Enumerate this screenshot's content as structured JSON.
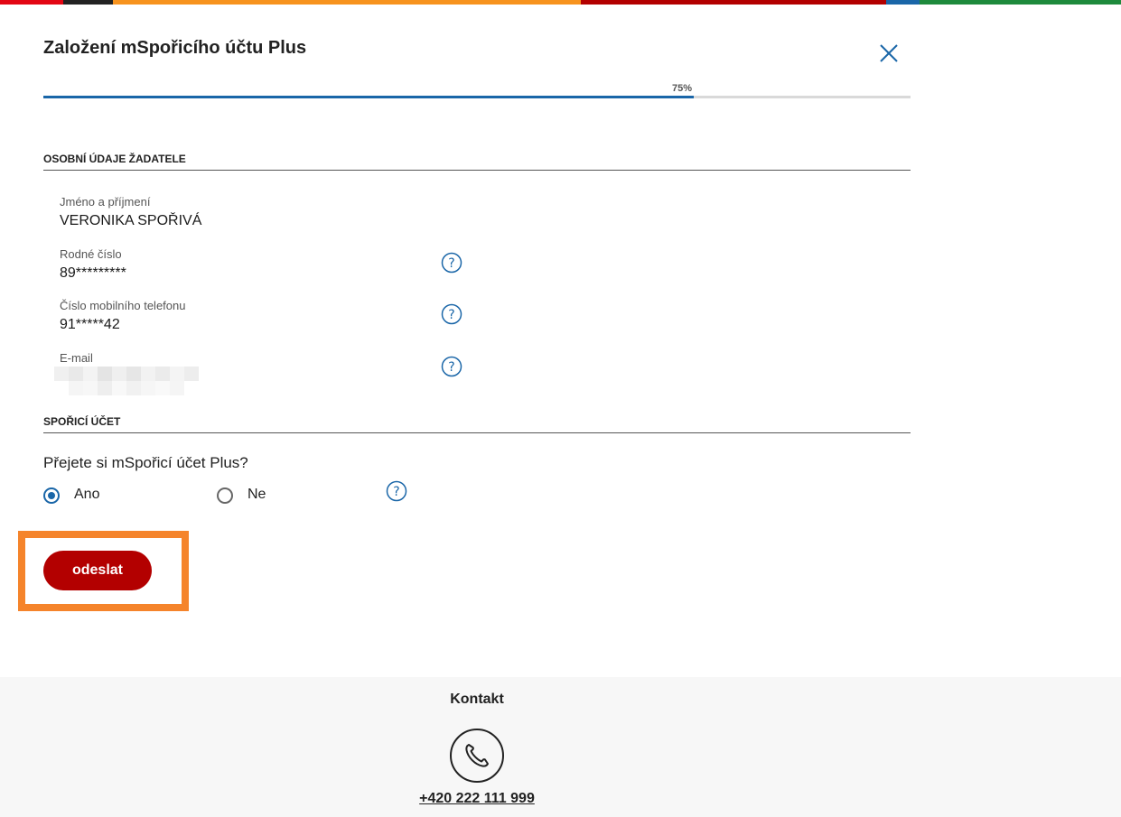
{
  "colors": {
    "topbar": [
      "#e30613",
      "#222222",
      "#f7931e",
      "#b30000",
      "#1a66a8",
      "#1e8a3c"
    ],
    "accent_blue": "#1a66a8",
    "button_red": "#b30000",
    "highlight_orange": "#f5842b"
  },
  "form": {
    "title": "Založení mSpořicího účtu Plus",
    "close_icon": "close-icon",
    "progress": {
      "label": "75%",
      "value": 75
    }
  },
  "personal": {
    "section_title": "OSOBNÍ ÚDAJE ŽADATELE",
    "fields": [
      {
        "label": "Jméno a příjmení",
        "value": "VERONIKA SPOŘIVÁ"
      },
      {
        "label": "Rodné číslo",
        "value": "89*********"
      },
      {
        "label": "Číslo mobilního telefonu",
        "value": "91*****42"
      },
      {
        "label": "E-mail",
        "value": ""
      }
    ],
    "help_icon": "question-circle-icon"
  },
  "account": {
    "section_title": "SPOŘICÍ ÚČET",
    "question": "Přejete si mSpořicí účet Plus?",
    "options": [
      {
        "label": "Ano",
        "selected": true
      },
      {
        "label": "Ne",
        "selected": false
      }
    ]
  },
  "actions": {
    "submit_label": "odeslat"
  },
  "footer": {
    "title": "Kontakt",
    "phone_icon": "phone-icon",
    "phone": "+420 222 111 999"
  }
}
